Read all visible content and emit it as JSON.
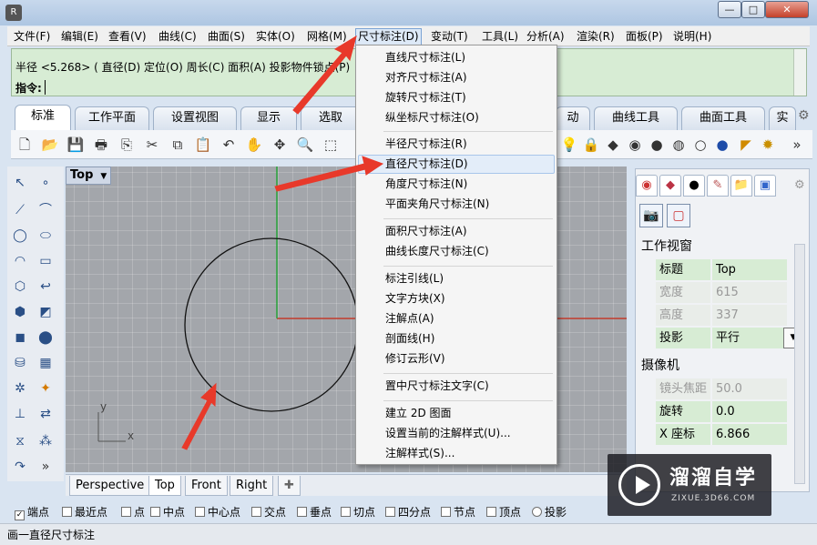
{
  "window": {
    "logo": "R",
    "min_glyph": "—",
    "max_glyph": "□",
    "close_glyph": "✕"
  },
  "menubar": {
    "items": [
      "文件(F)",
      "编辑(E)",
      "查看(V)",
      "曲线(C)",
      "曲面(S)",
      "实体(O)",
      "网格(M)",
      "尺寸标注(D)",
      "变动(T)",
      "工具(L)",
      "分析(A)",
      "渲染(R)",
      "面板(P)",
      "说明(H)"
    ],
    "active_index": 7
  },
  "command": {
    "history": "半径 <5.268> ( 直径(D)  定位(O)  周长(C)  面积(A)  投影物件锁点(P)",
    "prompt": "指令:",
    "input_value": ""
  },
  "toolbar_tabs": {
    "items": [
      "标准",
      "工作平面",
      "设置视图",
      "显示",
      "选取",
      "动",
      "曲线工具",
      "曲面工具",
      "实"
    ],
    "selected_index": 0
  },
  "viewport": {
    "name": "Top",
    "axis_y_label": "y",
    "axis_x_label": "x",
    "accent_x_axis": "#c0392b",
    "accent_y_axis": "#27a23a"
  },
  "viewport_tabs": {
    "items": [
      "Perspective",
      "Top",
      "Front",
      "Right"
    ],
    "selected_index": 1,
    "add_glyph": "✚"
  },
  "dimension_menu": {
    "items": [
      {
        "label": "直线尺寸标注(L)",
        "group": 0
      },
      {
        "label": "对齐尺寸标注(A)",
        "group": 0
      },
      {
        "label": "旋转尺寸标注(T)",
        "group": 0
      },
      {
        "label": "纵坐标尺寸标注(O)",
        "group": 0
      },
      {
        "label": "半径尺寸标注(R)",
        "group": 1
      },
      {
        "label": "直径尺寸标注(D)",
        "group": 1
      },
      {
        "label": "角度尺寸标注(N)",
        "group": 1
      },
      {
        "label": "平面夹角尺寸标注(N)",
        "group": 1
      },
      {
        "label": "面积尺寸标注(A)",
        "group": 2
      },
      {
        "label": "曲线长度尺寸标注(C)",
        "group": 2
      },
      {
        "label": "标注引线(L)",
        "group": 3
      },
      {
        "label": "文字方块(X)",
        "group": 3
      },
      {
        "label": "注解点(A)",
        "group": 3
      },
      {
        "label": "剖面线(H)",
        "group": 3
      },
      {
        "label": "修订云形(V)",
        "group": 3
      },
      {
        "label": "置中尺寸标注文字(C)",
        "group": 4
      },
      {
        "label": "建立 2D 图面",
        "group": 5
      },
      {
        "label": "设置当前的注解样式(U)...",
        "group": 5
      },
      {
        "label": "注解样式(S)...",
        "group": 5
      }
    ],
    "hover_index": 5
  },
  "properties_panel": {
    "section_viewport": "工作视窗",
    "rows_viewport": [
      {
        "key": "标题",
        "value": "Top",
        "enabled": true
      },
      {
        "key": "宽度",
        "value": "615",
        "enabled": false
      },
      {
        "key": "高度",
        "value": "337",
        "enabled": false
      },
      {
        "key": "投影",
        "value": "平行",
        "enabled": true
      }
    ],
    "section_camera": "摄像机",
    "rows_camera": [
      {
        "key": "镜头焦距",
        "value": "50.0",
        "enabled": false
      },
      {
        "key": "旋转",
        "value": "0.0",
        "enabled": true
      },
      {
        "key": "X 座标",
        "value": "6.866",
        "enabled": true
      }
    ],
    "select_glyph": "▼"
  },
  "osnap": {
    "items": [
      {
        "label": "端点",
        "checked": true
      },
      {
        "label": "最近点",
        "checked": false
      },
      {
        "label": "点",
        "checked": false
      },
      {
        "label": "中点",
        "checked": false
      },
      {
        "label": "中心点",
        "checked": false
      },
      {
        "label": "交点",
        "checked": false
      },
      {
        "label": "垂点",
        "checked": false
      },
      {
        "label": "切点",
        "checked": false
      },
      {
        "label": "四分点",
        "checked": false
      },
      {
        "label": "节点",
        "checked": false
      },
      {
        "label": "顶点",
        "checked": false
      },
      {
        "label": "投影",
        "checked": false
      }
    ]
  },
  "status": {
    "text": "画一直径尺寸标注"
  },
  "watermark": {
    "title": "溜溜自学",
    "url": "ZIXUE.3D66.COM"
  }
}
